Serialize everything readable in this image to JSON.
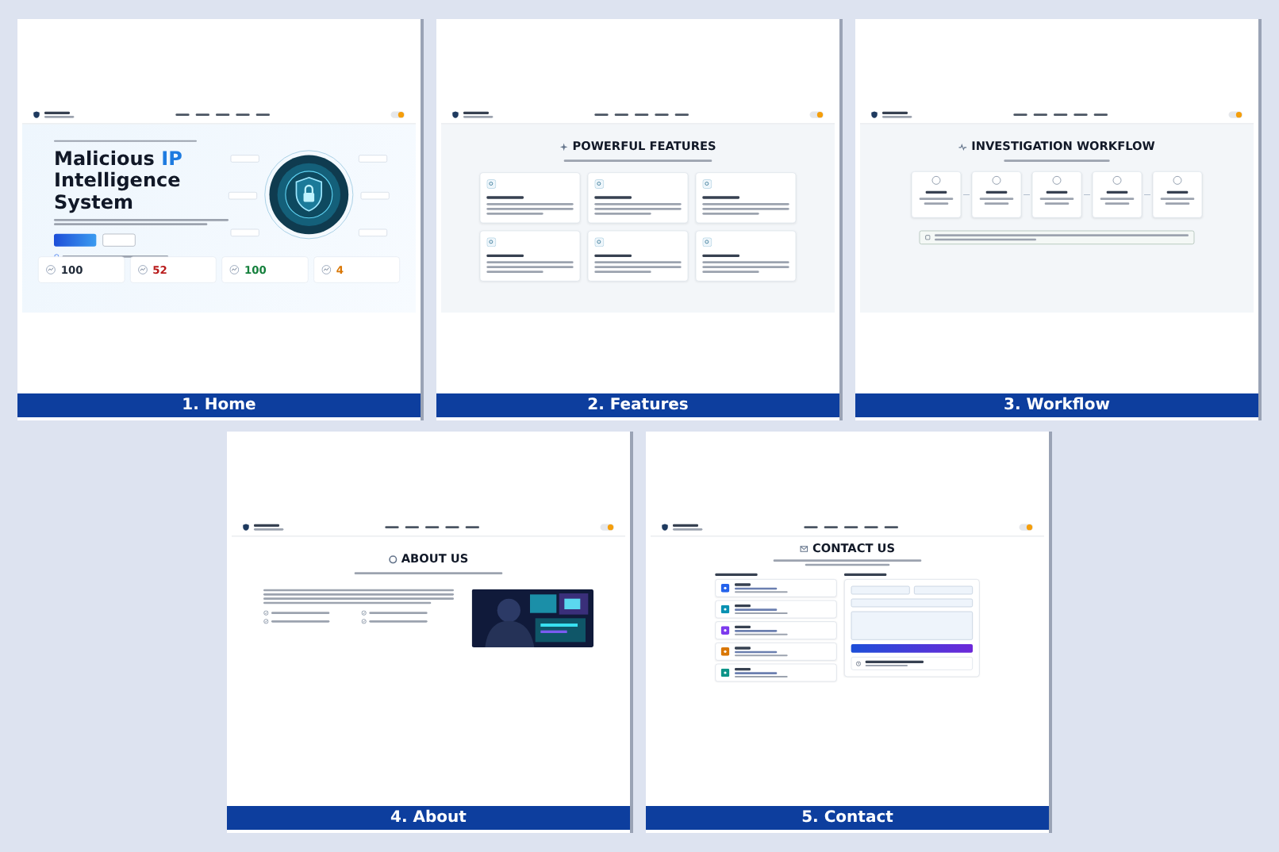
{
  "panels": [
    {
      "kind": "home",
      "caption": "1. Home",
      "title_start": "Malicious",
      "title_highlight": "IP",
      "title_end": "Intelligence System",
      "stats": [
        {
          "value": "100",
          "color": "#1f2937"
        },
        {
          "value": "52",
          "color": "#b91c1c"
        },
        {
          "value": "100",
          "color": "#15803d"
        },
        {
          "value": "4",
          "color": "#d97706"
        }
      ]
    },
    {
      "kind": "features",
      "caption": "2. Features",
      "title": "POWERFUL FEATURES"
    },
    {
      "kind": "workflow",
      "caption": "3. Workflow",
      "title": "INVESTIGATION WORKFLOW"
    },
    {
      "kind": "about",
      "caption": "4. About",
      "title": "ABOUT US"
    },
    {
      "kind": "contact",
      "caption": "5. Contact",
      "title": "CONTACT US",
      "contacts": [
        {
          "color": "#2563eb"
        },
        {
          "color": "#0891b2"
        },
        {
          "color": "#7c3aed"
        },
        {
          "color": "#d97706"
        },
        {
          "color": "#0d9488"
        }
      ]
    }
  ]
}
